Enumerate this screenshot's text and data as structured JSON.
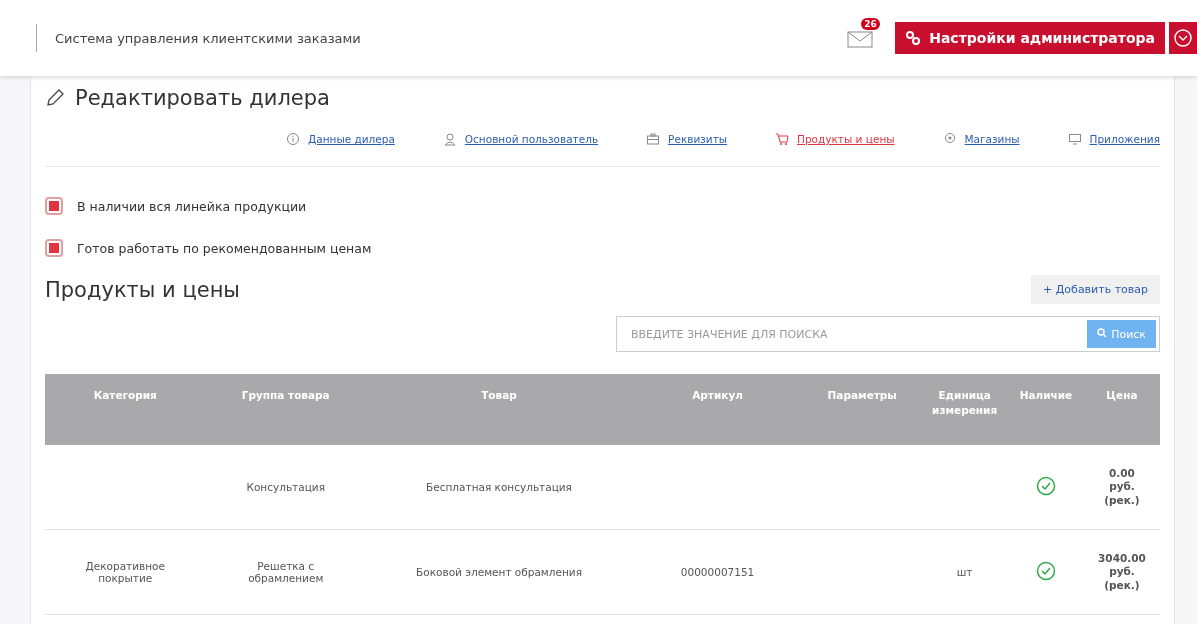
{
  "header": {
    "title": "Система управления клиентскими заказами",
    "mail_badge": "26",
    "admin_button": "Настройки администратора"
  },
  "page_title": "Редактировать дилера",
  "nav": [
    {
      "label": "Данные дилера",
      "selected": false
    },
    {
      "label": "Основной пользователь",
      "selected": false
    },
    {
      "label": "Реквизиты",
      "selected": false
    },
    {
      "label": "Продукты и цены",
      "selected": true
    },
    {
      "label": "Магазины",
      "selected": false
    },
    {
      "label": "Приложения",
      "selected": false
    }
  ],
  "options": [
    {
      "label": "В наличии вся линейка продукции",
      "checked": true
    },
    {
      "label": "Готов работать по рекомендованным ценам",
      "checked": true
    }
  ],
  "section_title": "Продукты и цены",
  "add_button": "+ Добавить товар",
  "search": {
    "placeholder": "ВВЕДИТЕ ЗНАЧЕНИЕ ДЛЯ ПОИСКА",
    "button": "Поиск"
  },
  "table": {
    "columns": [
      "Категория",
      "Группа товара",
      "Товар",
      "Артикул",
      "Параметры",
      "Единица измерения",
      "Наличие",
      "Цена"
    ],
    "rows": [
      {
        "category": "",
        "group": "Консультация",
        "product": "Бесплатная консультация",
        "sku": "",
        "params": "",
        "unit": "",
        "available": true,
        "price": "0.00 руб. (рек.)"
      },
      {
        "category": "Декоративное покрытие",
        "group": "Решетка с обрамлением",
        "product": "Боковой элемент обрамления",
        "sku": "00000007151",
        "params": "",
        "unit": "шт",
        "available": true,
        "price": "3040.00 руб. (рек.)"
      }
    ]
  }
}
